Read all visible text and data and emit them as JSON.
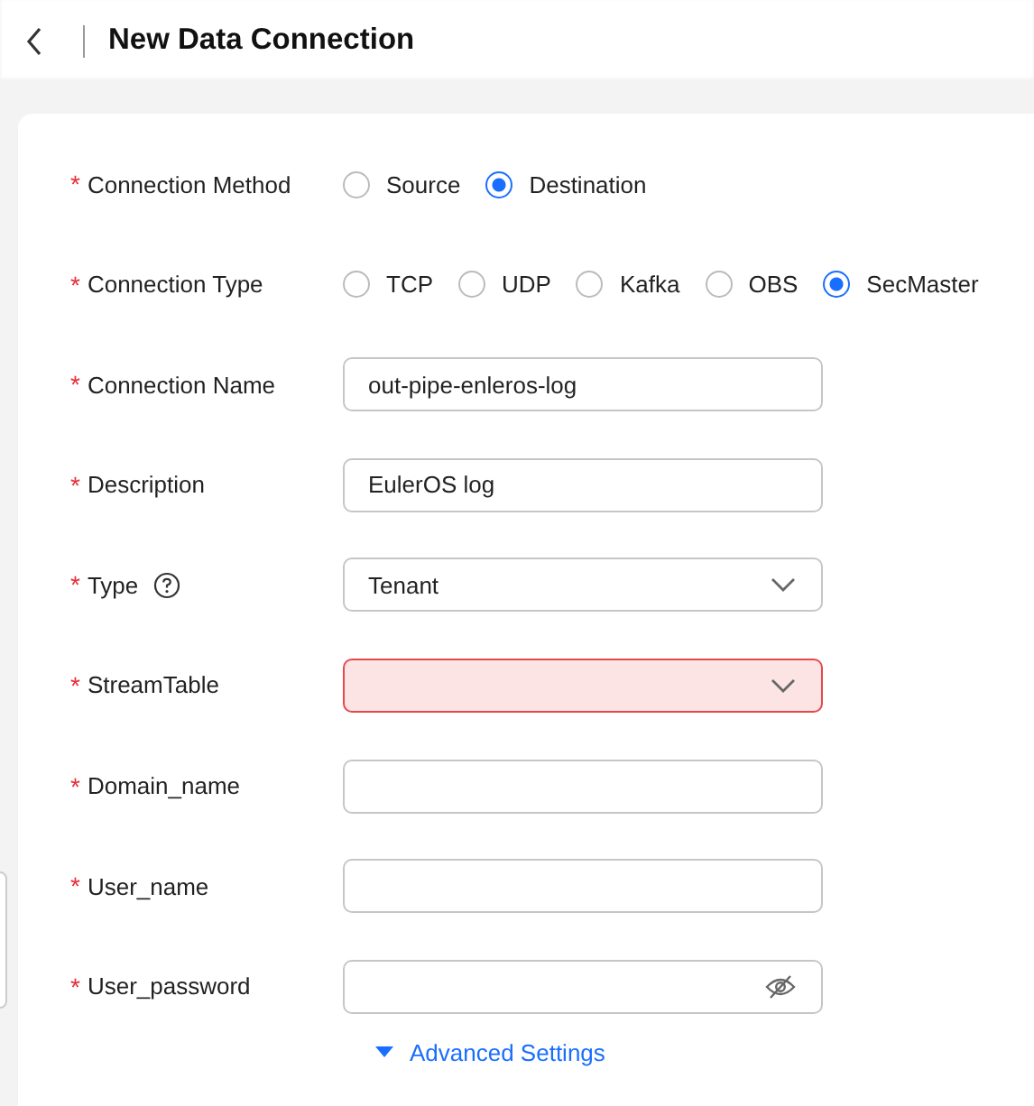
{
  "page": {
    "title": "New Data Connection"
  },
  "fields": [
    {
      "kind": "radio",
      "required_mark": "*",
      "label": "Connection Method",
      "options": [
        {
          "label": "Source",
          "selected": false
        },
        {
          "label": "Destination",
          "selected": true
        }
      ]
    },
    {
      "kind": "radio",
      "required_mark": "*",
      "label": "Connection Type",
      "options": [
        {
          "label": "TCP",
          "selected": false
        },
        {
          "label": "UDP",
          "selected": false
        },
        {
          "label": "Kafka",
          "selected": false
        },
        {
          "label": "OBS",
          "selected": false
        },
        {
          "label": "SecMaster",
          "selected": true
        }
      ]
    },
    {
      "kind": "text",
      "required_mark": "*",
      "label": "Connection Name",
      "value": "out-pipe-enleros-log"
    },
    {
      "kind": "text",
      "required_mark": "*",
      "label": "Description",
      "value": "EulerOS log"
    },
    {
      "kind": "select",
      "required_mark": "*",
      "label": "Type",
      "help": true,
      "value": "Tenant"
    },
    {
      "kind": "select",
      "required_mark": "*",
      "label": "StreamTable",
      "error": true
    },
    {
      "kind": "text",
      "required_mark": "*",
      "label": "Domain_name"
    },
    {
      "kind": "text",
      "required_mark": "*",
      "label": "User_name"
    },
    {
      "kind": "password",
      "required_mark": "*",
      "label": "User_password"
    }
  ],
  "advanced": {
    "label": "Advanced Settings",
    "expanded": false
  }
}
